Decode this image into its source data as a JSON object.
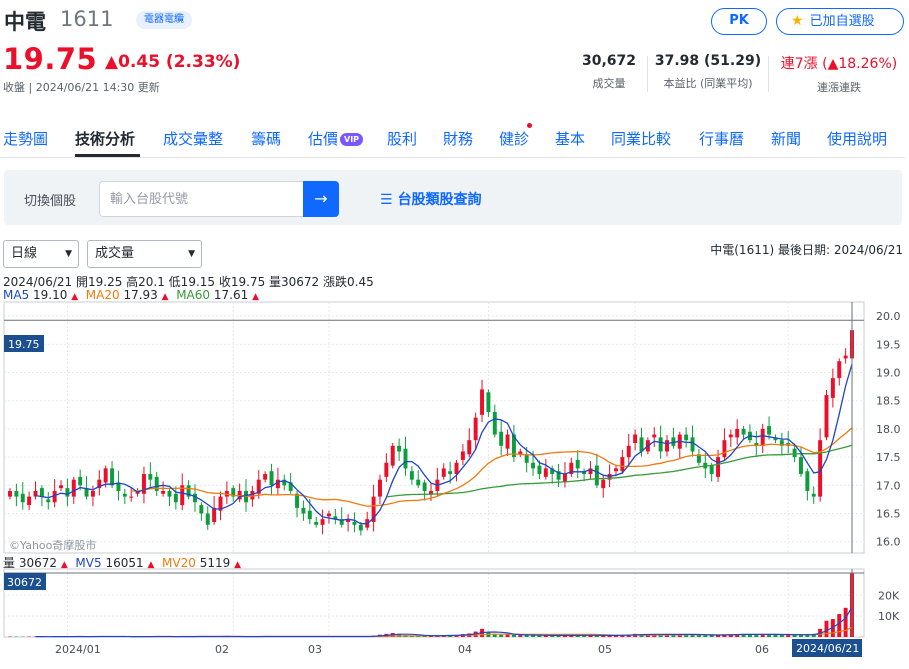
{
  "header": {
    "stock_name": "中電",
    "stock_code": "1611",
    "category": "電器電纜",
    "pk_label": "PK",
    "watchlist_label": "已加自選股",
    "price": "19.75",
    "change": "▲0.45 (2.33%)",
    "close_status": "收盤 | 2024/06/21 14:30 更新",
    "stats": [
      {
        "value": "30,672",
        "label": "成交量"
      },
      {
        "value": "37.98 (51.29)",
        "label": "本益比 (同業平均)"
      },
      {
        "value_prefix": "連7漲",
        "value_suffix": " (▲18.26%)",
        "label": "連漲連跌"
      }
    ]
  },
  "nav": {
    "tabs": [
      "走勢圖",
      "技術分析",
      "成交彙整",
      "籌碼",
      "估價",
      "股利",
      "財務",
      "健診",
      "基本",
      "同業比較",
      "行事曆",
      "新聞",
      "使用說明"
    ],
    "vip_badge": "VIP"
  },
  "search": {
    "label": "切換個股",
    "placeholder": "輸入台股代號",
    "submit_icon": "arrow-right-icon",
    "category_query": "台股類股查詢"
  },
  "controls": {
    "period": "日線",
    "indicator": "成交量"
  },
  "chart_meta": "中電(1611)  最後日期: 2024/06/21",
  "ohlc": "2024/06/21 開19.25 高20.1 低19.15 收19.75 量30672 漲跌0.45",
  "ma": {
    "ma5_label": "MA5",
    "ma5_value": "19.10",
    "ma20_label": "MA20",
    "ma20_value": "17.93",
    "ma60_label": "MA60",
    "ma60_value": "17.61"
  },
  "volume_legend": {
    "vol_label": "量",
    "vol_value": "30672",
    "mv5_label": "MV5",
    "mv5_value": "16051",
    "mv20_label": "MV20",
    "mv20_value": "5119"
  },
  "watermark": "©Yahoo奇摩股市",
  "colors": {
    "up": "#eb0f29",
    "down": "#0c9e3c",
    "ma5": "#1f46c7",
    "ma20": "#f07a12",
    "ma60": "#3a9b3a",
    "accent": "#0f69ff"
  },
  "chart_data": {
    "type": "line",
    "price_axis": {
      "ylim": [
        15.8,
        20.25
      ],
      "ticks": [
        "20.0",
        "19.5",
        "19.0",
        "18.5",
        "18.0",
        "17.5",
        "17.0",
        "16.5",
        "16.0"
      ]
    },
    "volume_axis": {
      "ylim": [
        0,
        30672
      ],
      "ticks": [
        "20K",
        "10K"
      ]
    },
    "x_labels": [
      "2024/01",
      "02",
      "03",
      "04",
      "05",
      "06"
    ],
    "last_price_label": "19.75",
    "last_volume_label": "30672",
    "last_date_label": "2024/06/21",
    "closes": [
      16.9,
      16.8,
      16.7,
      16.8,
      16.9,
      16.8,
      16.7,
      16.9,
      17.0,
      16.8,
      17.1,
      17.0,
      16.8,
      16.9,
      17.1,
      17.3,
      17.0,
      16.9,
      16.8,
      16.8,
      16.9,
      17.2,
      17.1,
      16.9,
      16.9,
      16.8,
      16.7,
      17.0,
      16.8,
      16.7,
      16.5,
      16.3,
      16.6,
      16.8,
      16.9,
      16.8,
      16.9,
      16.7,
      16.9,
      17.1,
      17.2,
      17.0,
      17.1,
      17.0,
      16.9,
      16.6,
      16.5,
      16.4,
      16.3,
      16.4,
      16.5,
      16.4,
      16.3,
      16.4,
      16.3,
      16.2,
      16.4,
      16.8,
      17.1,
      17.4,
      17.7,
      17.6,
      17.3,
      17.1,
      17.0,
      16.9,
      16.9,
      17.1,
      17.3,
      17.2,
      17.4,
      17.6,
      17.8,
      18.2,
      18.7,
      18.3,
      17.9,
      17.7,
      17.9,
      17.5,
      17.6,
      17.4,
      17.3,
      17.2,
      17.3,
      17.2,
      17.1,
      17.2,
      17.4,
      17.3,
      17.2,
      17.3,
      17.0,
      17.1,
      17.2,
      17.3,
      17.5,
      17.7,
      17.9,
      17.6,
      17.8,
      17.9,
      17.6,
      17.8,
      17.7,
      17.9,
      17.8,
      17.6,
      17.4,
      17.3,
      17.2,
      17.5,
      17.8,
      17.9,
      18.0,
      17.9,
      17.8,
      17.7,
      18.0,
      17.9,
      17.8,
      17.7,
      17.7,
      17.5,
      17.2,
      16.9,
      16.8,
      17.8,
      18.6,
      18.9,
      19.2,
      19.3,
      19.75
    ],
    "volumes": [
      210,
      180,
      150,
      170,
      190,
      160,
      140,
      220,
      200,
      180,
      250,
      230,
      190,
      210,
      260,
      300,
      220,
      200,
      180,
      170,
      190,
      280,
      240,
      210,
      200,
      180,
      170,
      260,
      210,
      190,
      260,
      340,
      280,
      230,
      210,
      190,
      200,
      180,
      220,
      260,
      280,
      230,
      240,
      220,
      210,
      240,
      230,
      250,
      230,
      220,
      240,
      220,
      210,
      230,
      220,
      250,
      300,
      700,
      1100,
      1500,
      1900,
      1400,
      900,
      700,
      600,
      550,
      580,
      700,
      900,
      800,
      1000,
      1400,
      1700,
      2600,
      3900,
      2200,
      1500,
      1100,
      1200,
      1000,
      900,
      850,
      800,
      750,
      800,
      750,
      700,
      750,
      900,
      850,
      800,
      850,
      700,
      750,
      800,
      850,
      1000,
      1200,
      1500,
      1100,
      1300,
      1400,
      1100,
      1300,
      1200,
      1400,
      1300,
      1100,
      900,
      850,
      800,
      1000,
      1200,
      1300,
      1400,
      1300,
      1200,
      1100,
      1400,
      1300,
      1200,
      1100,
      1100,
      1000,
      1000,
      1200,
      1500,
      3900,
      7800,
      8600,
      11000,
      14000,
      30672
    ]
  }
}
